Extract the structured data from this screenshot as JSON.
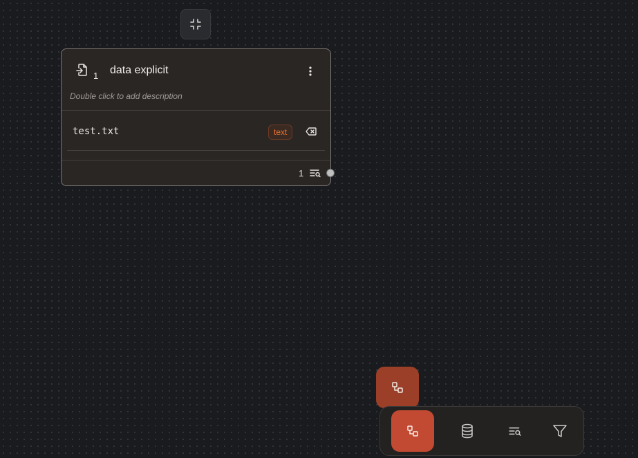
{
  "canvas_controls": {
    "collapse_icon": "collapse-icon"
  },
  "node": {
    "icon": "file-import-icon",
    "count": "1",
    "title": "data explicit",
    "description": "Double click to add description",
    "menu_icon": "kebab-icon",
    "files": [
      {
        "name": "test.txt",
        "type": "text",
        "remove_icon": "backspace-icon"
      }
    ],
    "footer": {
      "count": "1",
      "icon": "list-search-icon"
    }
  },
  "floating_button": {
    "icon": "nodes-icon"
  },
  "toolbar": {
    "items": [
      {
        "icon": "nodes-icon",
        "active": true
      },
      {
        "icon": "database-icon",
        "active": false
      },
      {
        "icon": "list-search-icon",
        "active": false
      },
      {
        "icon": "filter-icon",
        "active": false
      }
    ]
  },
  "colors": {
    "accent": "#c24a32",
    "accent_dark": "#9c3f28",
    "badge_text": "#e8722f",
    "canvas_bg": "#1a1b1e",
    "node_bg": "#2a2624"
  }
}
